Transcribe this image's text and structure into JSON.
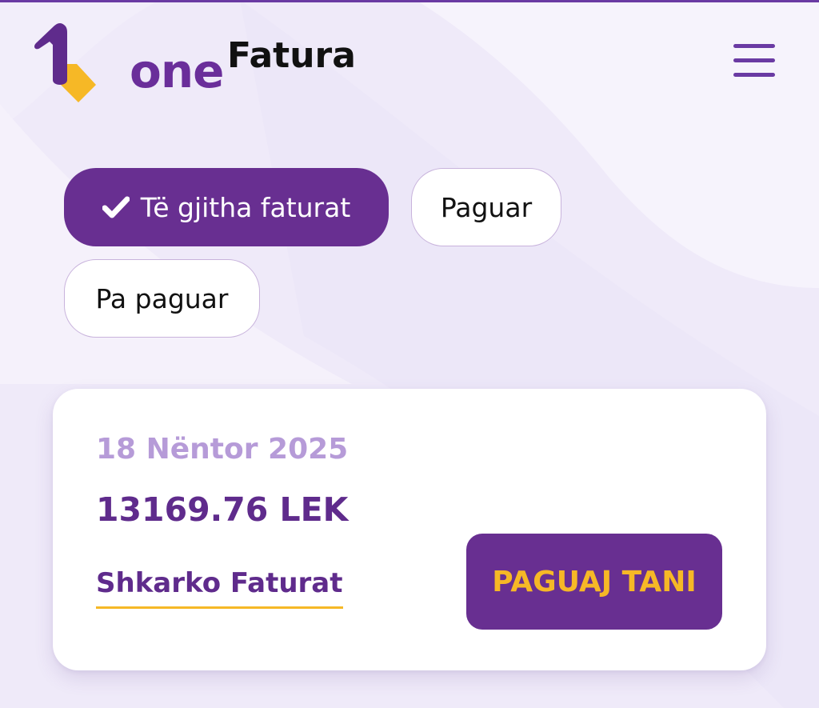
{
  "header": {
    "logo_text": "one",
    "app_title": "Fatura",
    "menu_icon": "hamburger-menu-icon"
  },
  "filters": {
    "all_label": "Të gjitha faturat",
    "paid_label": "Paguar",
    "unpaid_label": "Pa paguar",
    "selected": "all",
    "check_icon": "check-icon"
  },
  "invoice": {
    "date": "18 Nëntor 2025",
    "amount": "13169.76 LEK",
    "download_label": "Shkarko Faturat",
    "pay_label": "PAGUAJ TANI"
  },
  "colors": {
    "primary_purple": "#682f91",
    "accent_yellow": "#f6b826",
    "date_lilac": "#b69bd8",
    "background": "#efeaf9"
  }
}
